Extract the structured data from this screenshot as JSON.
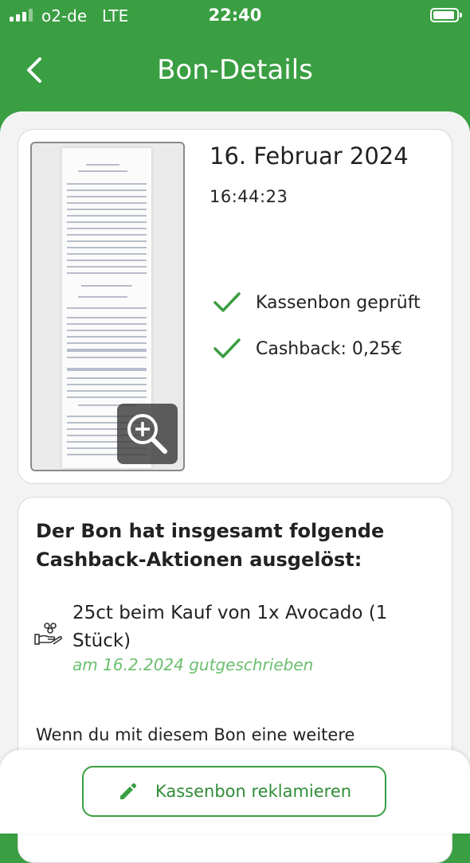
{
  "status_bar": {
    "carrier": "o2-de",
    "network": "LTE",
    "time": "22:40"
  },
  "header": {
    "title": "Bon-Details"
  },
  "receipt": {
    "date": "16. Februar 2024",
    "time": "16:44:23",
    "checks": [
      "Kassenbon geprüft",
      "Cashback: 0,25€"
    ]
  },
  "cashback": {
    "heading": "Der Bon hat insgesamt folgende Cashback-Aktionen ausgelöst:",
    "items": [
      {
        "text": "25ct beim Kauf von 1x Avocado (1 Stück)",
        "status": "am 16.2.2024 gutgeschrieben"
      }
    ],
    "note": "Wenn du mit diesem Bon eine weitere"
  },
  "actions": {
    "reclaim_label": "Kassenbon reklamieren"
  },
  "colors": {
    "brand_green": "#3a9e42",
    "success_green": "#6bbf6e"
  }
}
